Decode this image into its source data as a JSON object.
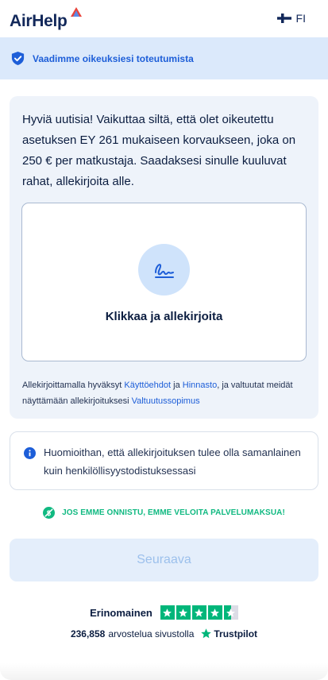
{
  "header": {
    "logo_text": "AirHelp",
    "language": "FI"
  },
  "banner": {
    "text": "Vaadimme oikeuksiesi toteutumista"
  },
  "card": {
    "intro": "Hyviä uutisia! Vaikuttaa siltä, että olet oikeutettu asetuksen EY 261 mukaiseen korvaukseen, joka on 250 € per matkustaja. Saadaksesi sinulle kuuluvat rahat, allekirjoita alle.",
    "sign_label": "Klikkaa ja allekirjoita",
    "legal": {
      "part1": "Allekirjoittamalla hyväksyt ",
      "terms_link": "Käyttöehdot",
      "part2": " ja ",
      "pricing_link": "Hinnasto",
      "part3": ", ja valtuutat meidät näyttämään allekirjoituksesi ",
      "authorization_link": "Valtuutussopimus"
    }
  },
  "notice": {
    "text": "Huomioithan, että allekirjoituksen tulee olla samanlainen kuin henkilöllisyystodistuksessasi"
  },
  "guarantee": {
    "text": "JOS EMME ONNISTU, EMME VELOITA PALVELUMAKSUA!"
  },
  "next_button": {
    "label": "Seuraava"
  },
  "trustpilot": {
    "rating_label": "Erinomainen",
    "stars": 4.5,
    "review_count": "236,858",
    "review_text": "arvostelua sivustolla",
    "brand": "Trustpilot"
  },
  "colors": {
    "brand_navy": "#12285a",
    "accent_blue": "#1d5ed8",
    "banner_bg": "#dbe9fb",
    "green": "#10b981",
    "trustpilot_green": "#00b67a"
  }
}
